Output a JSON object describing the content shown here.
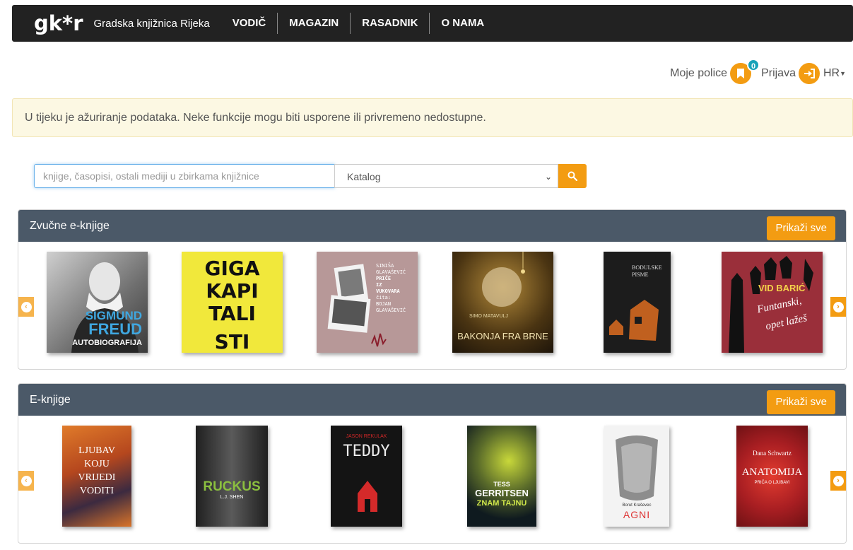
{
  "header": {
    "logo": "gk*r",
    "brand": "Gradska knjižnica Rijeka",
    "nav": [
      "VODIČ",
      "MAGAZIN",
      "RASADNIK",
      "O NAMA"
    ]
  },
  "user": {
    "shelves_label": "Moje police",
    "shelves_count": "0",
    "login_label": "Prijava",
    "language": "HR"
  },
  "alert": {
    "text": "U tijeku je ažuriranje podataka. Neke funkcije mogu biti usporene ili privremeno nedostupne."
  },
  "search": {
    "placeholder": "knjige, časopisi, ostali mediji u zbirkama knjižnice",
    "scope": "Katalog"
  },
  "sections": [
    {
      "title": "Zvučne e-knjige",
      "show_all": "Prikaži sve",
      "books": [
        {
          "lines": [
            "SIGMUND",
            "FREUD",
            "AUTOBIOGRAFIJA"
          ]
        },
        {
          "lines": [
            "GIGA",
            "KAPI",
            "TALI",
            "STI"
          ]
        },
        {
          "lines": [
            "SINIŠA",
            "GLAVAŠEVIĆ",
            "PRIČE",
            "IZ",
            "VUKOVARA",
            "čita:",
            "BOJAN",
            "GLAVAŠEVIĆ"
          ]
        },
        {
          "lines": [
            "SIMO MATAVULJ",
            "BAKONJA FRA BRNE"
          ]
        },
        {
          "lines": [
            "BODULSKE",
            "PISME"
          ]
        },
        {
          "lines": [
            "VID BARIĆ",
            "Funtanski,",
            "opet lažeš"
          ]
        }
      ]
    },
    {
      "title": "E-knjige",
      "show_all": "Prikaži sve",
      "books": [
        {
          "lines": [
            "LJUBAV",
            "KOJU",
            "VRIJEDI",
            "VODITI"
          ]
        },
        {
          "lines": [
            "RUCKUS",
            "L.J. SHEN"
          ]
        },
        {
          "lines": [
            "JASON REKULAK",
            "TEDDY"
          ]
        },
        {
          "lines": [
            "TESS",
            "GERRITSEN",
            "ZNAM TAJNU"
          ]
        },
        {
          "lines": [
            "Borut Kraševec",
            "AGNI"
          ]
        },
        {
          "lines": [
            "Dana Schwartz",
            "ANATOMIJA",
            "PRIČA O LJUBAVI"
          ]
        }
      ]
    }
  ]
}
